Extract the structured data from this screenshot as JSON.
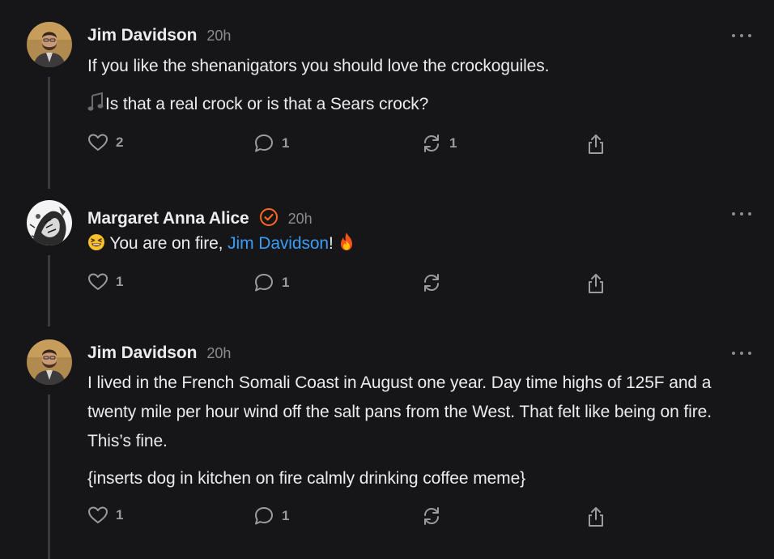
{
  "comments": [
    {
      "author": "Jim Davidson",
      "time": "20h",
      "paragraphs": [
        "If you like the shenanigators you should love the crockoguiles.",
        "Is that a real crock or is that a Sears crock?"
      ],
      "likes": "2",
      "replies": "1",
      "restacks": "1"
    },
    {
      "author": "Margaret Anna Alice",
      "time": "20h",
      "text_before": "You are on fire, ",
      "mention": "Jim Davidson",
      "text_after": "!",
      "likes": "1",
      "replies": "1"
    },
    {
      "author": "Jim Davidson",
      "time": "20h",
      "paragraphs": [
        "I lived in the French Somali Coast in August one year. Day time highs of 125F and a twenty mile per hour wind off the salt pans from the West. That felt like being on fire. This’s fine.",
        "{inserts dog in kitchen on fire calmly drinking coffee meme}"
      ],
      "likes": "1",
      "replies": "1"
    }
  ],
  "icons": {
    "like": "heart-icon",
    "reply": "speech-bubble-icon",
    "restack": "restack-icon",
    "share": "share-icon",
    "more": "ellipsis-icon",
    "verified": "verified-badge-icon",
    "music": "music-notes-icon",
    "laugh": "grinning-squinting-face-icon",
    "fire": "fire-icon"
  },
  "colors": {
    "background": "#161618",
    "mention": "#3b9cf5",
    "verified": "#ff6719",
    "meta": "#8b8b90"
  }
}
